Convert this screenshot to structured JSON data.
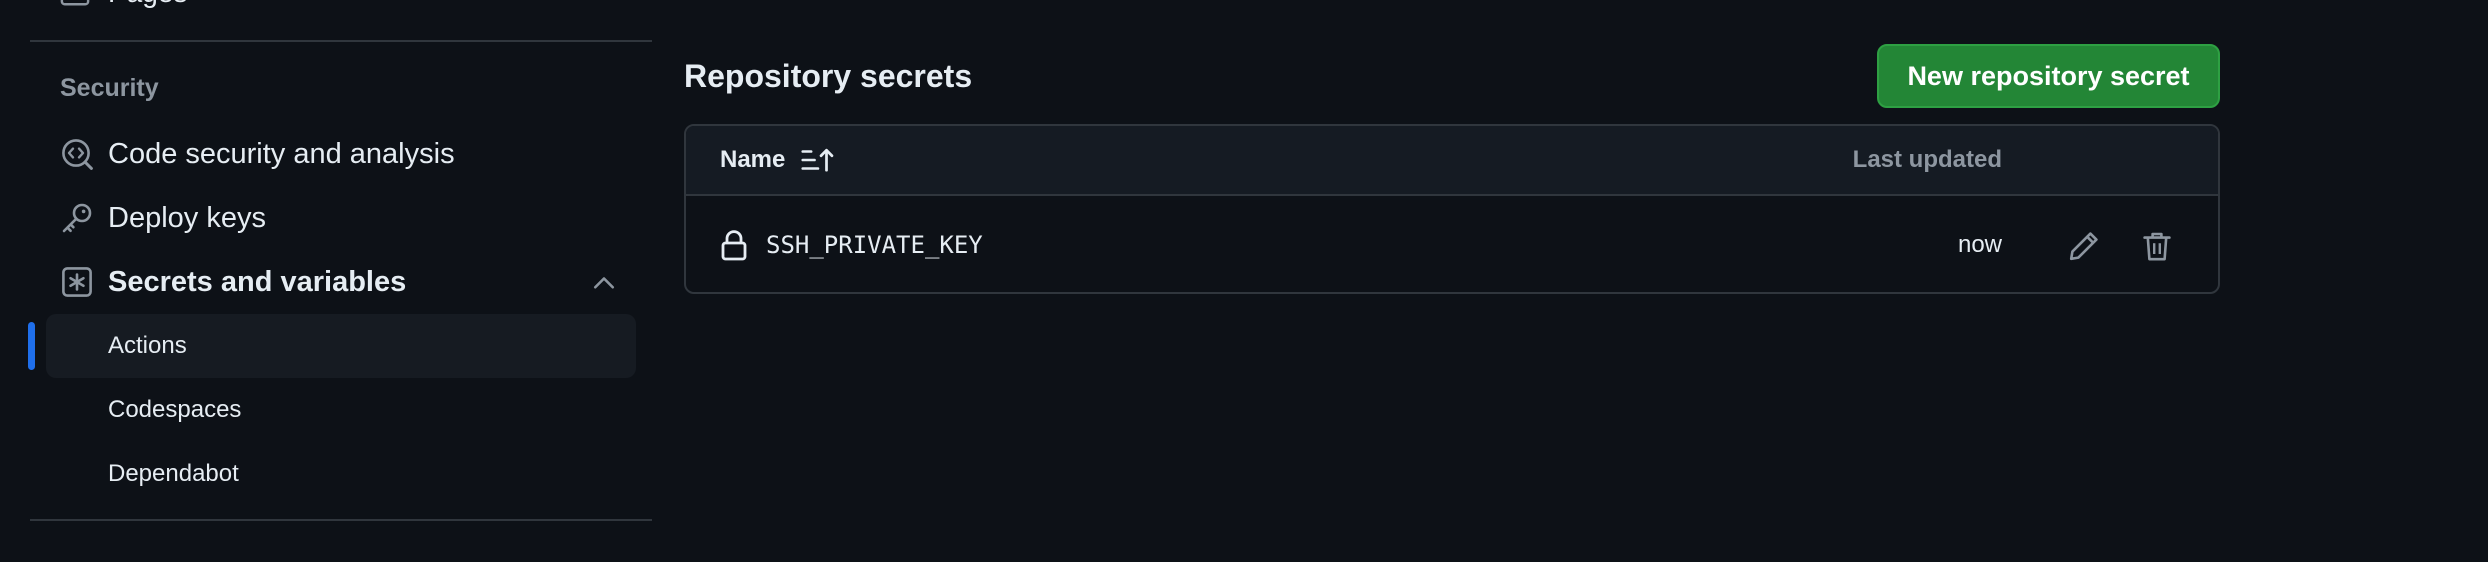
{
  "sidebar": {
    "partial_top_label": "Pages",
    "section_title": "Security",
    "items": [
      {
        "label": "Code security and analysis",
        "icon": "codescan-icon"
      },
      {
        "label": "Deploy keys",
        "icon": "key-icon"
      },
      {
        "label": "Secrets and variables",
        "icon": "asterisk-icon",
        "expanded": true
      }
    ],
    "sub_items": [
      {
        "label": "Actions",
        "active": true
      },
      {
        "label": "Codespaces",
        "active": false
      },
      {
        "label": "Dependabot",
        "active": false
      }
    ]
  },
  "main": {
    "title": "Repository secrets",
    "new_button_label": "New repository secret",
    "table": {
      "col_name": "Name",
      "col_updated": "Last updated",
      "rows": [
        {
          "name": "SSH_PRIVATE_KEY",
          "updated": "now"
        }
      ]
    }
  },
  "colors": {
    "background": "#0d1117",
    "accent_green": "#238636",
    "active_indicator": "#1f6feb",
    "muted_text": "#8d96a0",
    "border": "#30363d"
  }
}
